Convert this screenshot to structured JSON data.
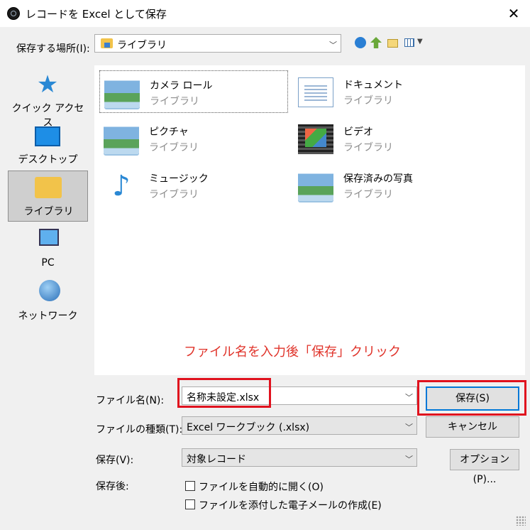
{
  "window": {
    "title": "レコードを Excel として保存",
    "close": "✕"
  },
  "toolbar": {
    "save_in_label": "保存する場所(I):",
    "location": "ライブラリ"
  },
  "places": [
    {
      "label": "クイック アクセス"
    },
    {
      "label": "デスクトップ"
    },
    {
      "label": "ライブラリ"
    },
    {
      "label": "PC"
    },
    {
      "label": "ネットワーク"
    }
  ],
  "items": [
    {
      "name": "カメラ ロール",
      "type": "ライブラリ"
    },
    {
      "name": "ドキュメント",
      "type": "ライブラリ"
    },
    {
      "name": "ピクチャ",
      "type": "ライブラリ"
    },
    {
      "name": "ビデオ",
      "type": "ライブラリ"
    },
    {
      "name": "ミュージック",
      "type": "ライブラリ"
    },
    {
      "name": "保存済みの写真",
      "type": "ライブラリ"
    }
  ],
  "annotation": "ファイル名を入力後「保存」クリック",
  "form": {
    "filename_label": "ファイル名(N):",
    "filename_value": "名称未設定.xlsx",
    "filetype_label": "ファイルの種類(T):",
    "filetype_value": "Excel ワークブック (.xlsx)",
    "save_label": "保存(V):",
    "save_value": "対象レコード",
    "after_label": "保存後:",
    "open_auto": "ファイルを自動的に開く(O)",
    "attach_mail": "ファイルを添付した電子メールの作成(E)"
  },
  "buttons": {
    "save": "保存(S)",
    "cancel": "キャンセル",
    "options": "オプション(P)..."
  },
  "colors": {
    "highlight": "#e0121e",
    "annotation": "#e0332a",
    "focus": "#0078d7"
  }
}
